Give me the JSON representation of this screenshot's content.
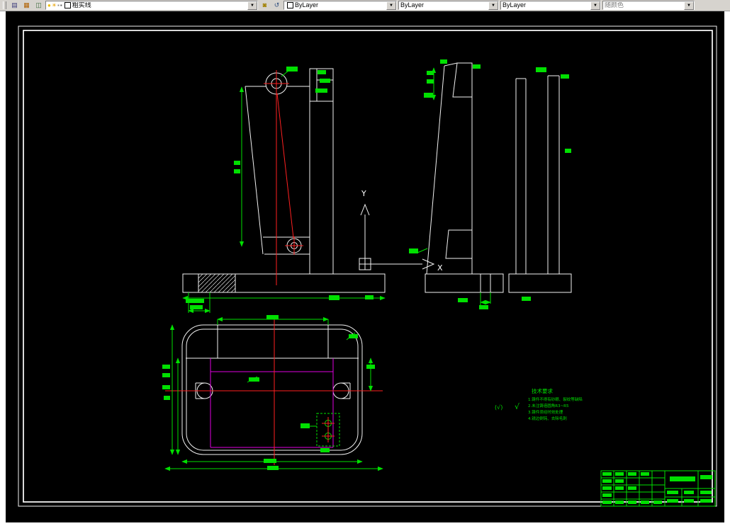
{
  "toolbar": {
    "layer_value": "粗实线",
    "color_value": "ByLayer",
    "linetype_value": "ByLayer",
    "lineweight_value": "ByLayer",
    "plot_style_value": "随颜色",
    "arrow_glyph": "▼"
  },
  "drawing": {
    "axis": {
      "x": "X",
      "y": "Y"
    },
    "tech_requirements": {
      "finish_prefix": "(√)",
      "finish_mark": "√",
      "title": "技术要求",
      "lines": [
        "1.铸件不得有砂眼、裂纹等缺陷",
        "2.未注铸造圆角R3~R5",
        "3.铸件须经时效处理",
        "4.锐边倒钝、去除毛刺"
      ]
    },
    "colors": {
      "outline": "#ffffff",
      "dimension": "#00e000",
      "centerline": "#ff2020",
      "hidden": "#e000e0",
      "background": "#000000"
    }
  }
}
